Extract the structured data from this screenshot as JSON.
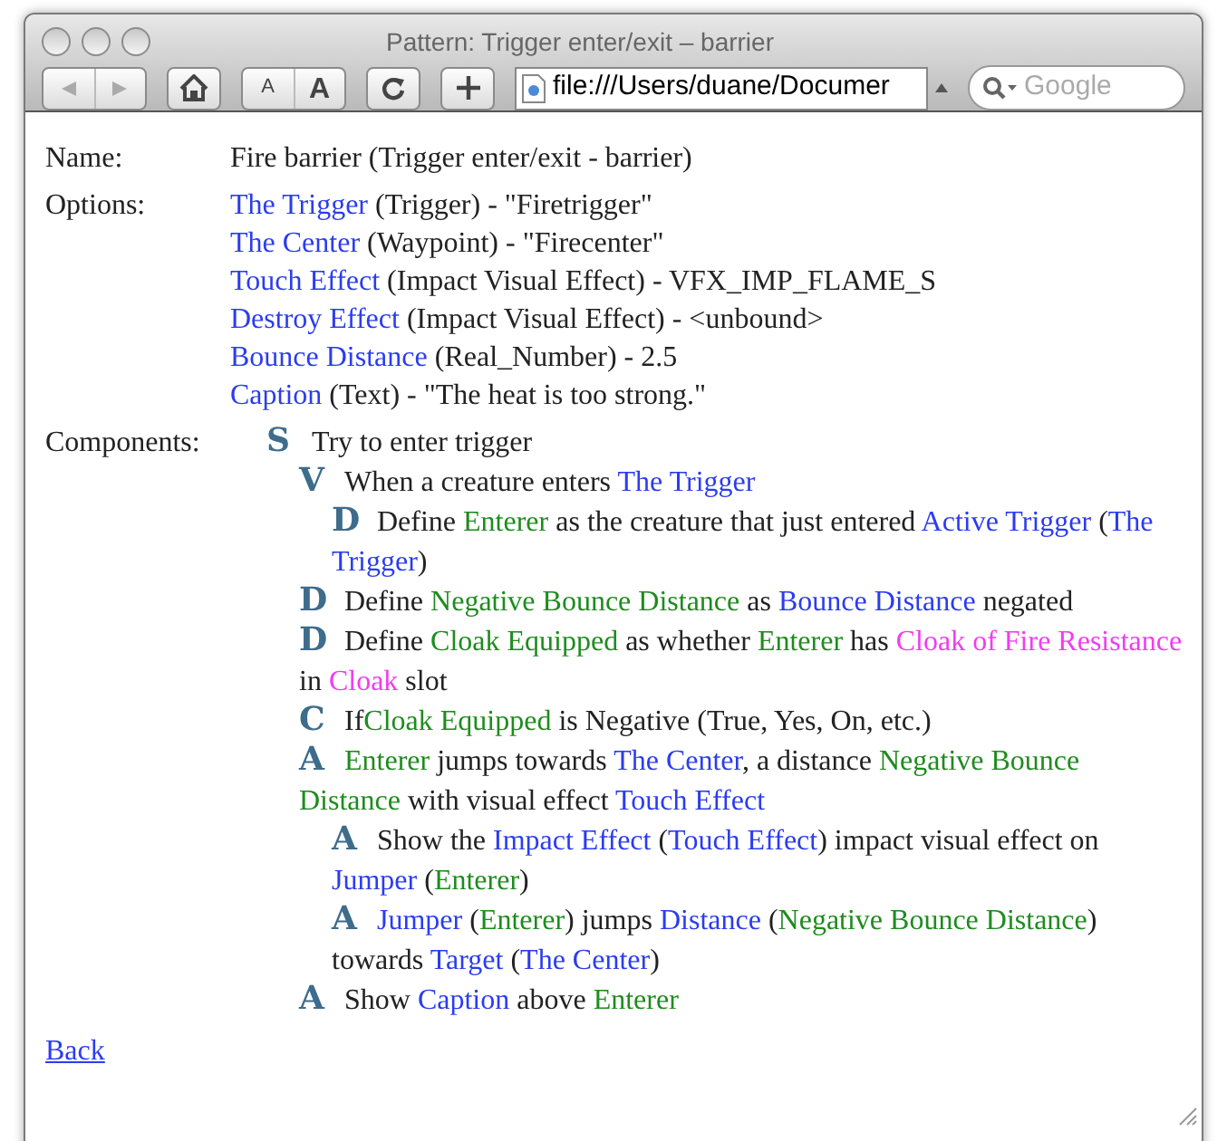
{
  "window": {
    "title": "Pattern: Trigger enter/exit – barrier"
  },
  "toolbar": {
    "text_small": "A",
    "text_large": "A",
    "address": "file:///Users/duane/Documer",
    "search": {
      "placeholder": "Google"
    }
  },
  "name": {
    "label": "Name:",
    "value": "Fire barrier (Trigger enter/exit - barrier)"
  },
  "options": {
    "label": "Options:",
    "items": [
      {
        "name": "The Trigger",
        "detail": "(Trigger) - \"Firetrigger\""
      },
      {
        "name": "The Center",
        "detail": "(Waypoint) - \"Firecenter\""
      },
      {
        "name": "Touch Effect",
        "detail": "(Impact Visual Effect) - VFX_IMP_FLAME_S"
      },
      {
        "name": "Destroy Effect",
        "detail": "(Impact Visual Effect) - <unbound>"
      },
      {
        "name": "Bounce Distance",
        "detail": "(Real_Number) - 2.5"
      },
      {
        "name": "Caption",
        "detail": "(Text) - \"The heat is too strong.\""
      }
    ]
  },
  "components": {
    "label": "Components:",
    "items": [
      {
        "badge": "S",
        "parts": [
          {
            "kind": "text",
            "text": "Try to enter trigger"
          }
        ],
        "children": [
          {
            "badge": "V",
            "parts": [
              {
                "kind": "text",
                "text": "When a creature enters "
              },
              {
                "kind": "ref",
                "text": "The Trigger"
              }
            ],
            "children": [
              {
                "badge": "D",
                "parts": [
                  {
                    "kind": "text",
                    "text": "Define "
                  },
                  {
                    "kind": "var",
                    "text": "Enterer"
                  },
                  {
                    "kind": "text",
                    "text": " as the creature that just entered "
                  },
                  {
                    "kind": "ref",
                    "text": "Active Trigger"
                  },
                  {
                    "kind": "text",
                    "text": " ("
                  },
                  {
                    "kind": "ref",
                    "text": "The Trigger"
                  },
                  {
                    "kind": "text",
                    "text": ")"
                  }
                ]
              }
            ]
          },
          {
            "badge": "D",
            "parts": [
              {
                "kind": "text",
                "text": "Define "
              },
              {
                "kind": "var",
                "text": "Negative Bounce Distance"
              },
              {
                "kind": "text",
                "text": " as "
              },
              {
                "kind": "ref",
                "text": "Bounce Distance"
              },
              {
                "kind": "text",
                "text": " negated"
              }
            ]
          },
          {
            "badge": "D",
            "parts": [
              {
                "kind": "text",
                "text": "Define "
              },
              {
                "kind": "var",
                "text": "Cloak Equipped"
              },
              {
                "kind": "text",
                "text": " as whether "
              },
              {
                "kind": "var",
                "text": "Enterer"
              },
              {
                "kind": "text",
                "text": " has "
              },
              {
                "kind": "item",
                "text": "Cloak of Fire Resistance"
              },
              {
                "kind": "text",
                "text": " in "
              },
              {
                "kind": "item",
                "text": "Cloak"
              },
              {
                "kind": "text",
                "text": " slot"
              }
            ]
          },
          {
            "badge": "C",
            "parts": [
              {
                "kind": "text",
                "text": "If"
              },
              {
                "kind": "var",
                "text": "Cloak Equipped"
              },
              {
                "kind": "text",
                "text": " is Negative (True, Yes, On, etc.)"
              }
            ]
          },
          {
            "badge": "A",
            "parts": [
              {
                "kind": "var",
                "text": "Enterer"
              },
              {
                "kind": "text",
                "text": " jumps towards "
              },
              {
                "kind": "ref",
                "text": "The Center"
              },
              {
                "kind": "text",
                "text": ", a distance "
              },
              {
                "kind": "var",
                "text": "Negative Bounce Distance"
              },
              {
                "kind": "text",
                "text": " with visual effect "
              },
              {
                "kind": "ref",
                "text": "Touch Effect"
              }
            ],
            "children": [
              {
                "badge": "A",
                "parts": [
                  {
                    "kind": "text",
                    "text": "Show the "
                  },
                  {
                    "kind": "ref",
                    "text": "Impact Effect"
                  },
                  {
                    "kind": "text",
                    "text": " ("
                  },
                  {
                    "kind": "ref",
                    "text": "Touch Effect"
                  },
                  {
                    "kind": "text",
                    "text": ") impact visual effect on "
                  },
                  {
                    "kind": "ref",
                    "text": "Jumper"
                  },
                  {
                    "kind": "text",
                    "text": " ("
                  },
                  {
                    "kind": "var",
                    "text": "Enterer"
                  },
                  {
                    "kind": "text",
                    "text": ")"
                  }
                ]
              },
              {
                "badge": "A",
                "parts": [
                  {
                    "kind": "ref",
                    "text": "Jumper"
                  },
                  {
                    "kind": "text",
                    "text": " ("
                  },
                  {
                    "kind": "var",
                    "text": "Enterer"
                  },
                  {
                    "kind": "text",
                    "text": ") jumps "
                  },
                  {
                    "kind": "ref",
                    "text": "Distance"
                  },
                  {
                    "kind": "text",
                    "text": " ("
                  },
                  {
                    "kind": "var",
                    "text": "Negative Bounce Distance"
                  },
                  {
                    "kind": "text",
                    "text": ") towards "
                  },
                  {
                    "kind": "ref",
                    "text": "Target"
                  },
                  {
                    "kind": "text",
                    "text": " ("
                  },
                  {
                    "kind": "ref",
                    "text": "The Center"
                  },
                  {
                    "kind": "text",
                    "text": ")"
                  }
                ]
              }
            ]
          },
          {
            "badge": "A",
            "parts": [
              {
                "kind": "text",
                "text": "Show "
              },
              {
                "kind": "ref",
                "text": "Caption"
              },
              {
                "kind": "text",
                "text": " above "
              },
              {
                "kind": "var",
                "text": "Enterer"
              }
            ]
          }
        ]
      }
    ]
  },
  "back_link": "Back"
}
